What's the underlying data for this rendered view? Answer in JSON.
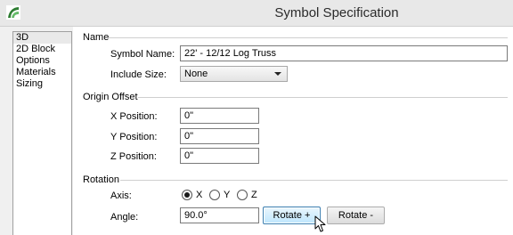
{
  "window": {
    "title": "Symbol Specification"
  },
  "sidebar": {
    "items": [
      {
        "label": "3D",
        "selected": true
      },
      {
        "label": "2D Block",
        "selected": false
      },
      {
        "label": "Options",
        "selected": false
      },
      {
        "label": "Materials",
        "selected": false
      },
      {
        "label": "Sizing",
        "selected": false
      }
    ]
  },
  "name_group": {
    "label": "Name",
    "symbol_name_label": "Symbol Name:",
    "symbol_name_value": "22' - 12/12 Log Truss",
    "include_size_label": "Include Size:",
    "include_size_value": "None"
  },
  "origin_group": {
    "label": "Origin Offset",
    "x_label": "X Position:",
    "x_value": "0\"",
    "y_label": "Y Position:",
    "y_value": "0\"",
    "z_label": "Z Position:",
    "z_value": "0\""
  },
  "rotation_group": {
    "label": "Rotation",
    "axis_label": "Axis:",
    "axis_options": [
      {
        "label": "X",
        "checked": true
      },
      {
        "label": "Y",
        "checked": false
      },
      {
        "label": "Z",
        "checked": false
      }
    ],
    "angle_label": "Angle:",
    "angle_value": "90.0°",
    "rotate_plus_label": "Rotate +",
    "rotate_minus_label": "Rotate -"
  },
  "icons": {
    "app": "app-logo-icon",
    "cursor": "mouse-pointer-icon"
  },
  "colors": {
    "focus_border": "#3c7fb1",
    "focus_fill": "#bee6fd"
  }
}
